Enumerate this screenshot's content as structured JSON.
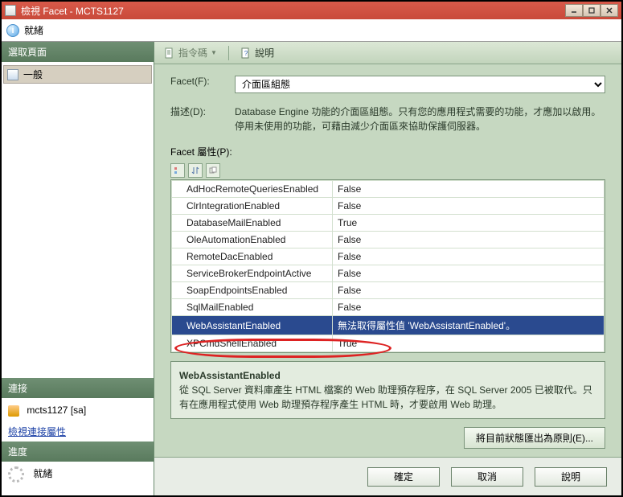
{
  "title": "檢視 Facet - MCTS1127",
  "status": {
    "ready": "就緒"
  },
  "sidebar": {
    "header1": "選取頁面",
    "item_general": "一般",
    "header2": "連接",
    "connection": "mcts1127 [sa]",
    "view_conn_link": "檢視連接屬性",
    "header3": "進度",
    "progress": "就緒"
  },
  "toolbar": {
    "script": "指令碼",
    "help": "說明"
  },
  "form": {
    "facet_label": "Facet(F):",
    "facet_value": "介面區組態",
    "desc_label": "描述(D):",
    "desc_value": "Database Engine 功能的介面區組態。只有您的應用程式需要的功能，才應加以啟用。停用未使用的功能，可藉由減少介面區來協助保護伺服器。",
    "props_label": "Facet 屬性(P):"
  },
  "grid": [
    {
      "k": "AdHocRemoteQueriesEnabled",
      "v": "False"
    },
    {
      "k": "ClrIntegrationEnabled",
      "v": "False"
    },
    {
      "k": "DatabaseMailEnabled",
      "v": "True"
    },
    {
      "k": "OleAutomationEnabled",
      "v": "False"
    },
    {
      "k": "RemoteDacEnabled",
      "v": "False"
    },
    {
      "k": "ServiceBrokerEndpointActive",
      "v": "False"
    },
    {
      "k": "SoapEndpointsEnabled",
      "v": "False"
    },
    {
      "k": "SqlMailEnabled",
      "v": "False"
    },
    {
      "k": "WebAssistantEnabled",
      "v": "無法取得屬性值 'WebAssistantEnabled'。",
      "sel": true
    },
    {
      "k": "XPCmdShellEnabled",
      "v": "True"
    }
  ],
  "help": {
    "name": "WebAssistantEnabled",
    "text": "從 SQL Server 資料庫產生 HTML 檔案的 Web 助理預存程序，在 SQL Server 2005 已被取代。只有在應用程式使用 Web 助理預存程序產生 HTML 時，才要啟用 Web 助理。"
  },
  "export_btn": "將目前狀態匯出為原則(E)...",
  "buttons": {
    "ok": "確定",
    "cancel": "取消",
    "help": "說明"
  }
}
